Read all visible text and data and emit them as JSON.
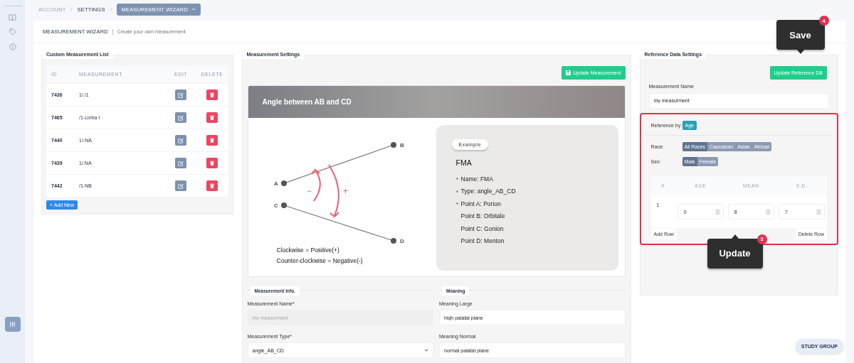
{
  "breadcrumb": [
    {
      "label": "ACCOUNT",
      "selected": false
    },
    {
      "label": "SETTINGS",
      "selected": false
    },
    {
      "label": "MEASUREMENT WIZARD",
      "selected": true
    }
  ],
  "page": {
    "title": "MEASUREMENT WIZARD",
    "subtitle": "Create your own measurement"
  },
  "measurement_list": {
    "legend": "Custom Measurement List",
    "columns": [
      "ID",
      "MEASUREMENT",
      "EDIT",
      "DELETE"
    ],
    "rows": [
      {
        "id": "7436",
        "measurement": "1/./1"
      },
      {
        "id": "7465",
        "measurement": "/1-Linha I"
      },
      {
        "id": "7440",
        "measurement": "1/-NA"
      },
      {
        "id": "7439",
        "measurement": "1/.NA"
      },
      {
        "id": "7442",
        "measurement": "/1-NB"
      }
    ],
    "add_button": "+ Add New"
  },
  "measurement_settings": {
    "legend": "Measurement Settings",
    "update_button": "Update Measurement",
    "card_title": "Angle between AB and CD",
    "diagram": {
      "points": [
        "A",
        "B",
        "C",
        "D"
      ],
      "minus": "−",
      "plus": "+",
      "notes": [
        "Clockwise = Positive(+)",
        "Counter-clockwise = Negative(-)"
      ]
    },
    "example": {
      "badge": "Example",
      "title": "FMA",
      "items": [
        {
          "text": "Name: FMA",
          "bulleted": true
        },
        {
          "text": "Type: angle_AB_CD",
          "bulleted": true
        },
        {
          "text": "Point A: Porion",
          "bulleted": true
        },
        {
          "text": "Point B: Orbitale",
          "bulleted": false
        },
        {
          "text": "Point C: Gonion",
          "bulleted": false
        },
        {
          "text": "Point D: Menton",
          "bulleted": false
        }
      ]
    }
  },
  "measurement_info": {
    "legend": "Measurement Info.",
    "name_label": "Measurement Name*",
    "name_placeholder": "my measurment",
    "name_disabled": true,
    "type_label": "Measurement Type*",
    "type_value": "angle_AB_CD"
  },
  "meaning": {
    "legend": "Meaning",
    "fields": [
      {
        "label": "Meaning Large",
        "value": "high palatal plane"
      },
      {
        "label": "Meaning Normal",
        "value": "normal palatal plane"
      }
    ]
  },
  "reference_data": {
    "legend": "Reference Data Settings",
    "update_button": "Update Reference DB",
    "name_label": "Measurement Name",
    "name_value": "my measurment",
    "highlighted": true,
    "reference_by": {
      "label": "Reference by:",
      "options": [
        {
          "label": "Age",
          "selected": true
        }
      ]
    },
    "race": {
      "label": "Race:",
      "options": [
        {
          "label": "All Races",
          "selected": true
        },
        {
          "label": "Caucasian",
          "selected": false
        },
        {
          "label": "Asian",
          "selected": false
        },
        {
          "label": "African",
          "selected": false
        }
      ]
    },
    "sex": {
      "label": "Sex:",
      "options": [
        {
          "label": "Male",
          "selected": true
        },
        {
          "label": "Female",
          "selected": false
        }
      ]
    },
    "table": {
      "columns": [
        "#",
        "AGE",
        "MEAN",
        "S.D."
      ],
      "rows": [
        {
          "index": "1",
          "age": "0",
          "mean": "8",
          "sd": "7"
        }
      ]
    },
    "add_row": "Add Row",
    "delete_row": "Delete Row",
    "save_callout": {
      "text": "Save",
      "badge": "4"
    },
    "update_callout": {
      "text": "Update",
      "badge": "3"
    }
  },
  "study_group_button": "STUDY GROUP"
}
